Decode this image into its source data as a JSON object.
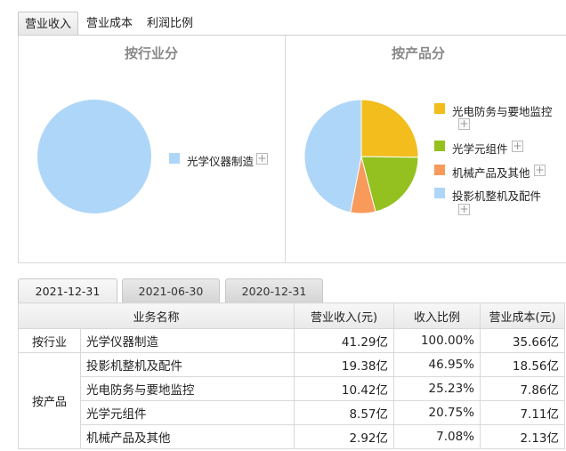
{
  "tabs": [
    "营业收入",
    "营业成本",
    "利润比例"
  ],
  "left_chart": {
    "title": "按行业分"
  },
  "right_chart": {
    "title": "按产品分"
  },
  "chart_data": [
    {
      "type": "pie",
      "title": "按行业分",
      "labels": [
        "光学仪器制造"
      ],
      "values": [
        100.0
      ],
      "colors": [
        "#aed6f8"
      ]
    },
    {
      "type": "pie",
      "title": "按产品分",
      "labels": [
        "光电防务与要地监控",
        "光学元组件",
        "机械产品及其他",
        "投影机整机及配件"
      ],
      "values": [
        25.23,
        20.75,
        7.08,
        46.95
      ],
      "colors": [
        "#f2bd1d",
        "#94c11f",
        "#f79a5b",
        "#aed6f8"
      ]
    }
  ],
  "date_tabs": [
    "2021-12-31",
    "2021-06-30",
    "2020-12-31"
  ],
  "table": {
    "headers": [
      "业务名称",
      "营业收入(元)",
      "收入比例",
      "营业成本(元)"
    ],
    "groups": [
      "按行业",
      "按产品"
    ],
    "rows": [
      {
        "name": "光学仪器制造",
        "revenue": "41.29亿",
        "ratio": "100.00%",
        "cost": "35.66亿"
      },
      {
        "name": "投影机整机及配件",
        "revenue": "19.38亿",
        "ratio": "46.95%",
        "cost": "18.56亿"
      },
      {
        "name": "光电防务与要地监控",
        "revenue": "10.42亿",
        "ratio": "25.23%",
        "cost": "7.86亿"
      },
      {
        "name": "光学元组件",
        "revenue": "8.57亿",
        "ratio": "20.75%",
        "cost": "7.11亿"
      },
      {
        "name": "机械产品及其他",
        "revenue": "2.92亿",
        "ratio": "7.08%",
        "cost": "2.13亿"
      }
    ]
  }
}
